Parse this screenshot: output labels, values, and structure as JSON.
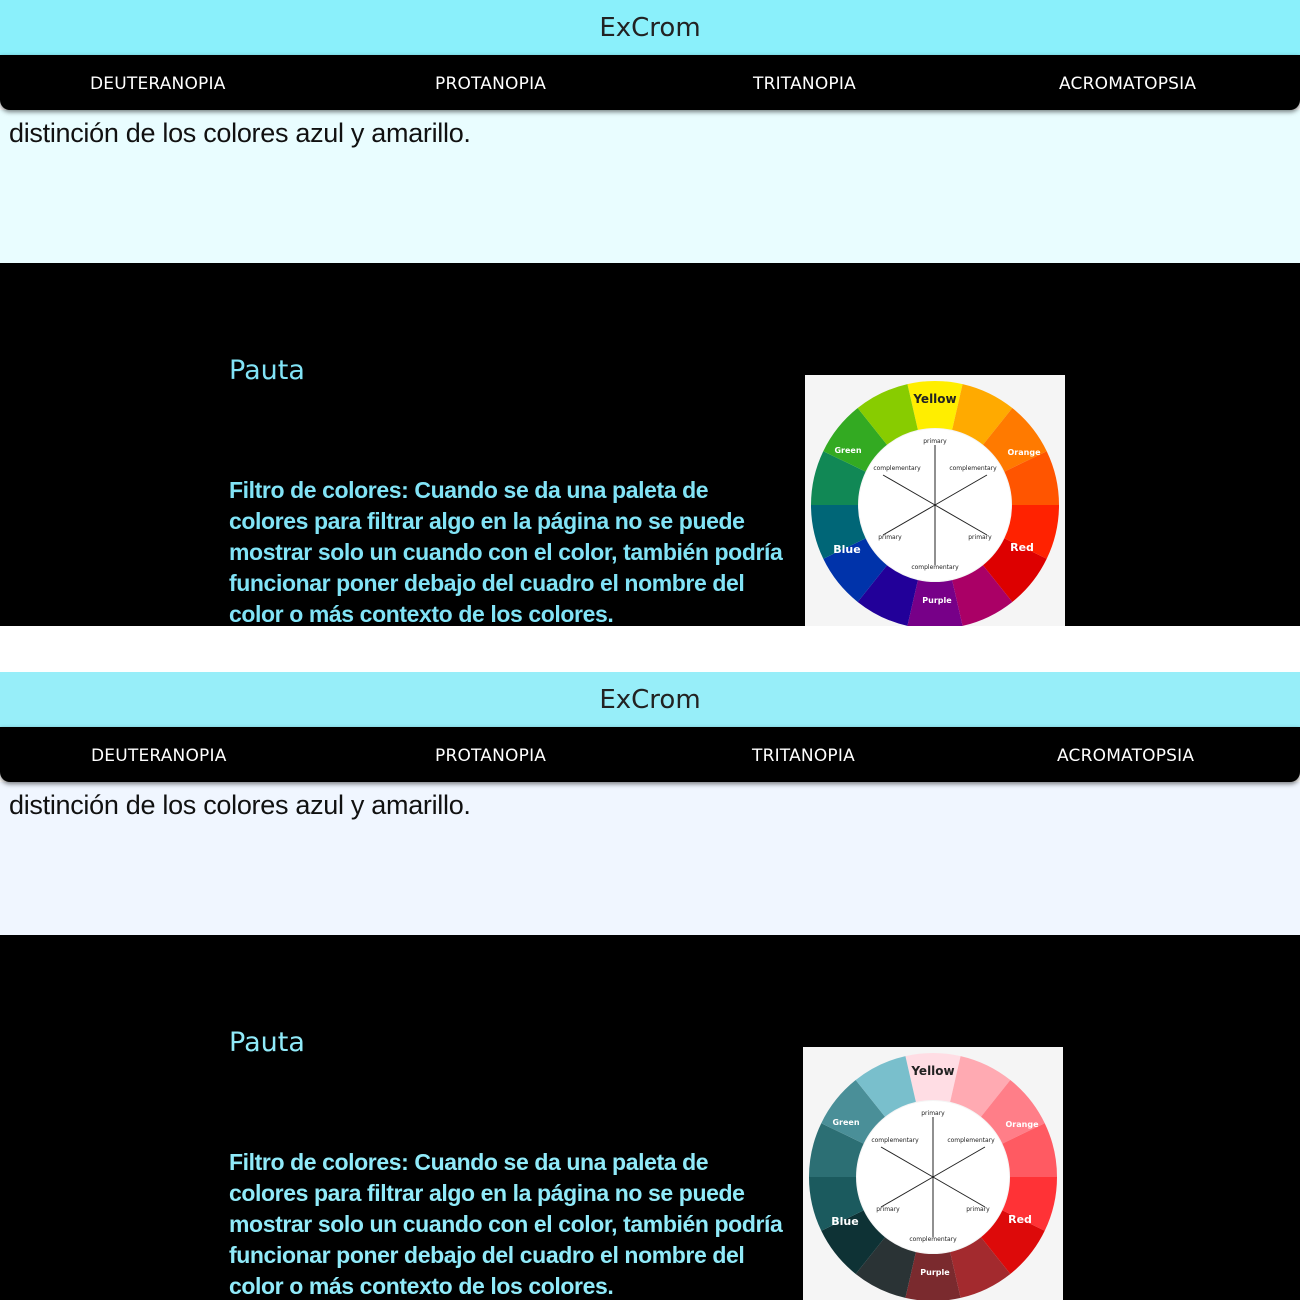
{
  "app_title": "ExCrom",
  "nav": {
    "items": [
      {
        "label": "DEUTERANOPIA"
      },
      {
        "label": "PROTANOPIA"
      },
      {
        "label": "TRITANOPIA"
      },
      {
        "label": "ACROMATOPSIA"
      }
    ]
  },
  "intro_text": "distinción de los colores azul y amarillo.",
  "section": {
    "title": "Pauta",
    "body": "Filtro de colores: Cuando se da una paleta de colores para filtrar algo en la página no se puede mostrar solo un cuando con el color, también podría funcionar poner debajo del cuadro el nombre del color o más contexto de los colores."
  },
  "color_wheel": {
    "center_labels": [
      "primary",
      "complementary",
      "complementary",
      "primary",
      "primary",
      "complementary"
    ],
    "segment_labels": [
      "Yellow",
      "Orange",
      "Red",
      "Purple",
      "Blue",
      "Green"
    ]
  },
  "views": [
    {
      "name": "original",
      "header_bg": "#8af0fb",
      "intro_bg": "#e9fdff",
      "accent_text": "#81e3f6",
      "wheel_colors": [
        "#ffee00",
        "#ffaa00",
        "#ff7a00",
        "#ff5500",
        "#ff2200",
        "#dd0000",
        "#aa0066",
        "#770088",
        "#220099",
        "#0033aa",
        "#006677",
        "#118855",
        "#33aa22",
        "#88cc00"
      ]
    },
    {
      "name": "filtered",
      "header_bg": "#97eef9",
      "intro_bg": "#f0f6ff",
      "accent_text": "#90eaf9",
      "wheel_colors": [
        "#ffdde4",
        "#ffaab2",
        "#ff7e88",
        "#ff5a62",
        "#ff3236",
        "#dd0a0a",
        "#a32a2e",
        "#7a2a2e",
        "#2a3335",
        "#0e3235",
        "#1b5a5e",
        "#2c6f74",
        "#4a8f98",
        "#79bfcc"
      ]
    }
  ]
}
